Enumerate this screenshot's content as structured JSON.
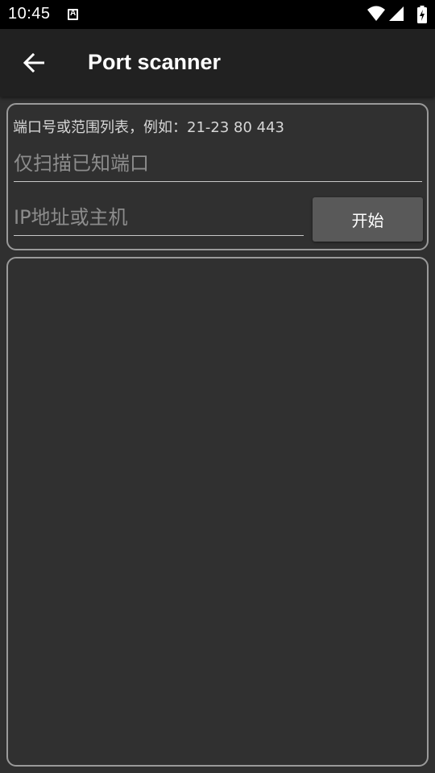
{
  "status_bar": {
    "time": "10:45"
  },
  "app_bar": {
    "title": "Port scanner",
    "back_icon": "arrow-left-icon"
  },
  "scan_form": {
    "hint": "端口号或范围列表，例如：21-23 80 443",
    "ports_placeholder": "仅扫描已知端口",
    "ports_value": "",
    "host_placeholder": "IP地址或主机",
    "host_value": "",
    "start_label": "开始"
  },
  "results": {
    "items": []
  },
  "colors": {
    "background": "#303030",
    "app_bar": "#212121",
    "status_bar": "#000000",
    "card_border": "#9a9a9a",
    "button": "#595959"
  }
}
